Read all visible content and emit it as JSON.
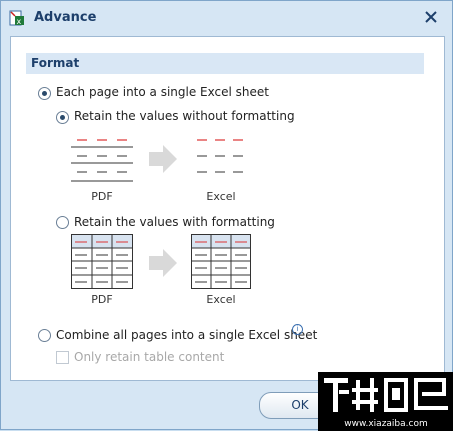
{
  "window": {
    "title": "Advance"
  },
  "section": {
    "label": "Format"
  },
  "options": {
    "each_page": "Each page into a single Excel sheet",
    "retain_without": "Retain the values without formatting",
    "retain_with": "Retain the values with formatting",
    "combine_all": "Combine all pages into a single Excel sheet",
    "only_table": "Only retain table content"
  },
  "captions": {
    "pdf": "PDF",
    "excel": "Excel"
  },
  "buttons": {
    "ok": "OK"
  },
  "watermark": {
    "url": "www.xiazaiba.com"
  },
  "state": {
    "each_page_selected": true,
    "retain_without_selected": true,
    "only_table_checked": false
  }
}
